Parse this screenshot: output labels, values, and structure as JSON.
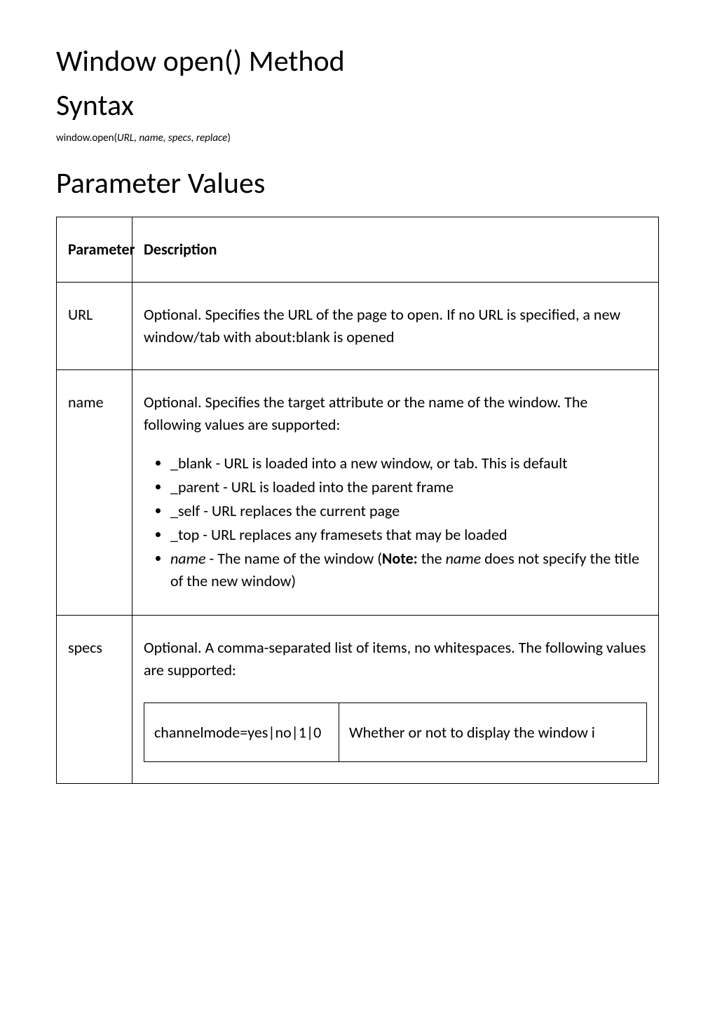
{
  "title": "Window open() Method",
  "syntax": {
    "heading": "Syntax",
    "prefix": "window.open(",
    "args": "URL, name, specs, replace",
    "suffix": ")"
  },
  "params": {
    "heading": "Parameter Values",
    "header_param": "Parameter",
    "header_desc": "Description",
    "rows": {
      "url": {
        "name": "URL",
        "desc": "Optional. Specifies the URL of the page to open. If no URL is specified, a new window/tab with about:blank is opened"
      },
      "name": {
        "name": "name",
        "desc": "Optional. Specifies the target attribute or the name of the window. The following values are supported:",
        "bullets": {
          "b0": "_blank - URL is loaded into a new window, or tab. This is default",
          "b1": "_parent - URL is loaded into the parent frame",
          "b2": "_self - URL replaces the current page",
          "b3": "_top - URL replaces any framesets that may be loaded",
          "b4_pre": "name",
          "b4_mid": " - The name of the window (",
          "b4_bold": "Note:",
          "b4_post1": " the ",
          "b4_post2": "name",
          "b4_post3": " does not specify the title of the new window)"
        }
      },
      "specs": {
        "name": "specs",
        "desc": "Optional. A comma-separated list of items, no whitespaces. The following values are supported:",
        "inner": {
          "k0": "channelmode=yes|no|1|0",
          "v0": "Whether or not to display the window i"
        }
      }
    }
  }
}
